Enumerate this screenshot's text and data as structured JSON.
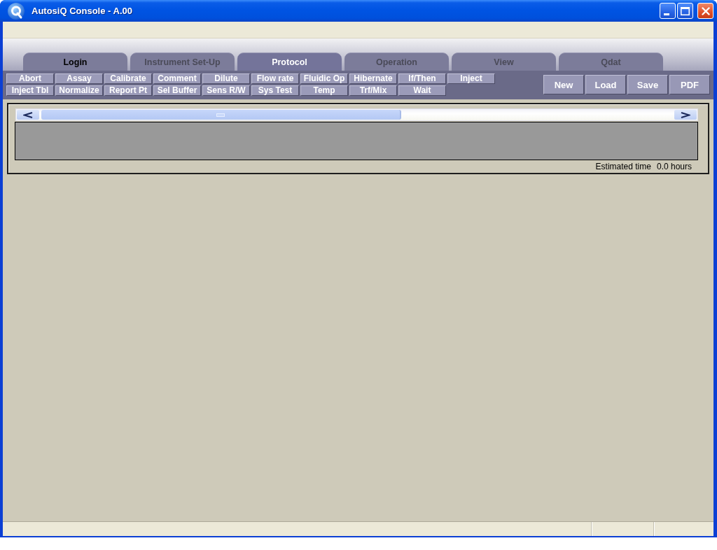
{
  "window": {
    "title": "AutosiQ Console - A.00"
  },
  "tabs": [
    {
      "label": "Login",
      "selected": false,
      "disabled": false
    },
    {
      "label": "Instrument Set-Up",
      "selected": false,
      "disabled": true
    },
    {
      "label": "Protocol",
      "selected": true,
      "disabled": false
    },
    {
      "label": "Operation",
      "selected": false,
      "disabled": true
    },
    {
      "label": "View",
      "selected": false,
      "disabled": true
    },
    {
      "label": "Qdat",
      "selected": false,
      "disabled": true
    }
  ],
  "command_buttons": [
    "Abort",
    "Assay",
    "Calibrate",
    "Comment",
    "Dilute",
    "Flow rate",
    "Fluidic Op",
    "Hibernate",
    "If/Then",
    "Inject",
    "Inject Tbl",
    "Normalize",
    "Report Pt",
    "Sel Buffer",
    "Sens R/W",
    "Sys Test",
    "Temp",
    "Trf/Mix",
    "Wait"
  ],
  "file_buttons": [
    "New",
    "Load",
    "Save",
    "PDF"
  ],
  "timeline": {
    "estimated_time_label": "Estimated time",
    "estimated_time_value": "0.0 hours"
  }
}
